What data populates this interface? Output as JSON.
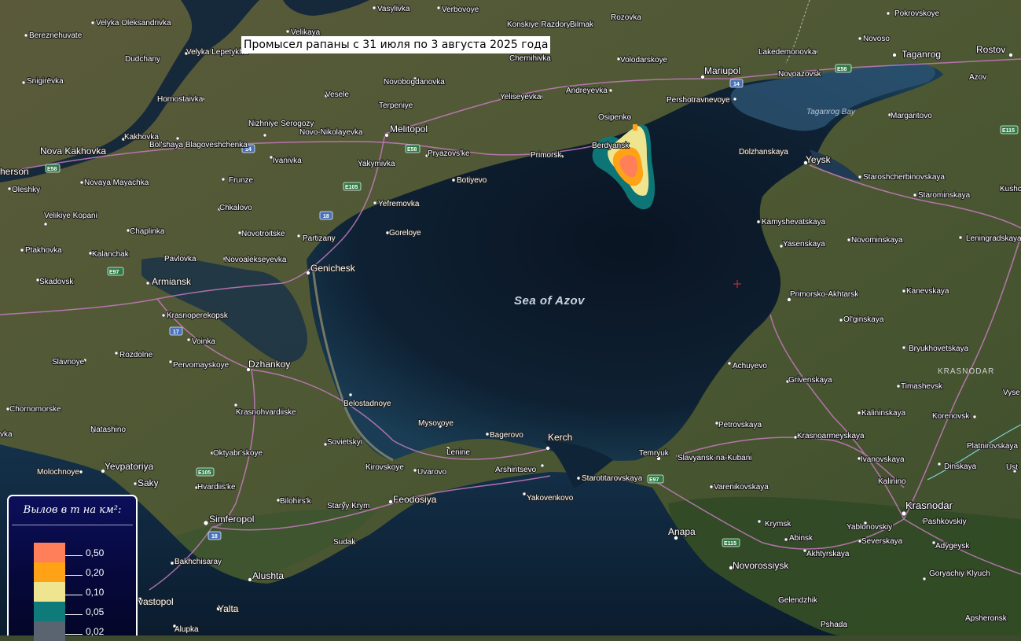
{
  "map": {
    "title": "Промысел рапаны с 31 июля по 3 августа 2025 года",
    "sea_label": "Sea of Azov",
    "bay_label": "Taganrog Bay",
    "region_label": "KRASNODAR",
    "colors": {
      "sea": "#0d1a2a",
      "land": "#4a5632",
      "roads": "#c77bbf"
    },
    "places": [
      {
        "id": "vasylivka",
        "name": "Vasylivka"
      },
      {
        "id": "verbovoye",
        "name": "Verbovoye"
      },
      {
        "id": "konskiye",
        "name": "Konskiye Razdory"
      },
      {
        "id": "bilmak",
        "name": "Bilmak"
      },
      {
        "id": "rozovka",
        "name": "Rozovka"
      },
      {
        "id": "pokrovskoye",
        "name": "Pokrovskoye"
      },
      {
        "id": "velyka",
        "name": "Velyka Oleksandrivka"
      },
      {
        "id": "bereznehuvate",
        "name": "Bereznehuvate"
      },
      {
        "id": "velikaya",
        "name": "Velikaya"
      },
      {
        "id": "novosvo",
        "name": "Novoso"
      },
      {
        "id": "dudchany",
        "name": "Dudchany"
      },
      {
        "id": "velyka_lep",
        "name": "Velyka Lepetykha"
      },
      {
        "id": "chernihivka",
        "name": "Chernihivka"
      },
      {
        "id": "volodarskoye",
        "name": "Volodarskoye"
      },
      {
        "id": "mariupol",
        "name": "Mariupol"
      },
      {
        "id": "lakedemonovka",
        "name": "Lakedemonovka"
      },
      {
        "id": "taganrog",
        "name": "Taganrog"
      },
      {
        "id": "rostov",
        "name": "Rostov"
      },
      {
        "id": "snigirevka",
        "name": "Snigirëvka"
      },
      {
        "id": "novobogdanovka",
        "name": "Novobogdanovka"
      },
      {
        "id": "novoazovsk",
        "name": "Novoazovsk"
      },
      {
        "id": "azov",
        "name": "Azov"
      },
      {
        "id": "andreyevka",
        "name": "Andreyevka"
      },
      {
        "id": "vesele",
        "name": "Vesele"
      },
      {
        "id": "yeliseyevka",
        "name": "Yeliseyevka"
      },
      {
        "id": "pershotravnevoye",
        "name": "Pershotravnevoye"
      },
      {
        "id": "hornostaivka",
        "name": "Hornostaivka"
      },
      {
        "id": "terpeniye",
        "name": "Terpeniye"
      },
      {
        "id": "osipenko",
        "name": "Osipenko"
      },
      {
        "id": "margaritovo",
        "name": "Margaritovo"
      },
      {
        "id": "nizhniye",
        "name": "Nizhniye Serogozy"
      },
      {
        "id": "melitopol",
        "name": "Melitopol"
      },
      {
        "id": "novo_nik",
        "name": "Novo-Nikolayevka"
      },
      {
        "id": "bolshaya",
        "name": "Bol'shaya Blagoveshchenka"
      },
      {
        "id": "kakhovka",
        "name": "Kakhovka"
      },
      {
        "id": "nova_kakhovka",
        "name": "Nova Kakhovka"
      },
      {
        "id": "pryazovske",
        "name": "Pryazovs'ke"
      },
      {
        "id": "primorsk",
        "name": "Primorsk"
      },
      {
        "id": "berdyansk",
        "name": "Berdyansk"
      },
      {
        "id": "kherson",
        "name": "Kherson"
      },
      {
        "id": "ivanivka",
        "name": "Ivanivka"
      },
      {
        "id": "yakymivka",
        "name": "Yakymivka"
      },
      {
        "id": "dolzhanskaya",
        "name": "Dolzhanskaya"
      },
      {
        "id": "yeysk",
        "name": "Yeysk"
      },
      {
        "id": "staroshcherb",
        "name": "Staroshcherbinovskaya"
      },
      {
        "id": "oleshky",
        "name": "Oleshky"
      },
      {
        "id": "novaya_may",
        "name": "Novaya Mayachka"
      },
      {
        "id": "botiyevo",
        "name": "Botiyevo"
      },
      {
        "id": "frunze",
        "name": "Frunze"
      },
      {
        "id": "starominskaya",
        "name": "Starominskaya"
      },
      {
        "id": "yefremovka",
        "name": "Yefremovka"
      },
      {
        "id": "chkalovo",
        "name": "Chkalovo"
      },
      {
        "id": "velikiye_kopani",
        "name": "Velikiye Kopani"
      },
      {
        "id": "kamyshevatskaya",
        "name": "Kamyshevatskaya"
      },
      {
        "id": "goreloye",
        "name": "Goreloye"
      },
      {
        "id": "novotroitske",
        "name": "Novotroitske"
      },
      {
        "id": "chaplinka",
        "name": "Chaplinka"
      },
      {
        "id": "partizany",
        "name": "Partizany"
      },
      {
        "id": "leningradskaya",
        "name": "Leningradskaya"
      },
      {
        "id": "novominskaya",
        "name": "Novominskaya"
      },
      {
        "id": "yasenskaya",
        "name": "Yasenskaya"
      },
      {
        "id": "ptakhovka",
        "name": "Ptakhovka"
      },
      {
        "id": "kalanchak",
        "name": "Kalanchak"
      },
      {
        "id": "pavlovka",
        "name": "Pavlovka"
      },
      {
        "id": "novoalekseyevka",
        "name": "Novoalekseyevka"
      },
      {
        "id": "genichesk",
        "name": "Genichesk"
      },
      {
        "id": "skadovsk",
        "name": "Skadovsk"
      },
      {
        "id": "armiansk",
        "name": "Armiansk"
      },
      {
        "id": "primorsko",
        "name": "Primorsko-Akhtarsk"
      },
      {
        "id": "kanevskaya",
        "name": "Kanevskaya"
      },
      {
        "id": "krasnoperekopsk",
        "name": "Krasnoperekopsk"
      },
      {
        "id": "olginskaya",
        "name": "Ol'ginskaya"
      },
      {
        "id": "voinka",
        "name": "Voinka"
      },
      {
        "id": "bryukhovetskaya",
        "name": "Bryukhovetskaya"
      },
      {
        "id": "rozdolne",
        "name": "Rozdolne"
      },
      {
        "id": "slavnoye",
        "name": "Slavnoye"
      },
      {
        "id": "pervomayskoye",
        "name": "Pervomayskoye"
      },
      {
        "id": "dzhankoy",
        "name": "Dzhankoy"
      },
      {
        "id": "achuyevo",
        "name": "Achuyevo"
      },
      {
        "id": "grivenskaya",
        "name": "Grivenskaya"
      },
      {
        "id": "timashevsk",
        "name": "Timashevsk"
      },
      {
        "id": "belostadnoye",
        "name": "Belostadnoye"
      },
      {
        "id": "chornomorske",
        "name": "Chornomorske"
      },
      {
        "id": "krasnohvardiiske",
        "name": "Krasnohvardiiske"
      },
      {
        "id": "kalininskaya",
        "name": "Kalininskaya"
      },
      {
        "id": "korenovsk",
        "name": "Korenovsk"
      },
      {
        "id": "mysovoye",
        "name": "Mysovoye"
      },
      {
        "id": "petrovskaya",
        "name": "Petrovskaya"
      },
      {
        "id": "natashino",
        "name": "Natashino"
      },
      {
        "id": "bagerovo",
        "name": "Bagerovo"
      },
      {
        "id": "kerch",
        "name": "Kerch"
      },
      {
        "id": "krasnoarmeyskaya",
        "name": "Krasnoarmeyskaya"
      },
      {
        "id": "sovietskyi",
        "name": "Sovietskyi"
      },
      {
        "id": "platnirovskaya",
        "name": "Platnirovskaya"
      },
      {
        "id": "lenine",
        "name": "Lenine"
      },
      {
        "id": "oktyabrskoye",
        "name": "Oktyabr'skoye"
      },
      {
        "id": "temryuk",
        "name": "Temryuk"
      },
      {
        "id": "slavyansk",
        "name": "Slavyansk-na-Kubani"
      },
      {
        "id": "ivanovskaya",
        "name": "Ivanovskaya"
      },
      {
        "id": "yevpatoriya",
        "name": "Yevpatoriya"
      },
      {
        "id": "kirovskoye",
        "name": "Kirovskoye"
      },
      {
        "id": "uvarovo",
        "name": "Uvarovo"
      },
      {
        "id": "arshintsevo",
        "name": "Arshintsevo"
      },
      {
        "id": "dinskaya",
        "name": "Dinskaya"
      },
      {
        "id": "molochnoye",
        "name": "Molochnoye"
      },
      {
        "id": "saky",
        "name": "Saky"
      },
      {
        "id": "starotitarovskaya",
        "name": "Starotitarovskaya"
      },
      {
        "id": "kalinino",
        "name": "Kalinino"
      },
      {
        "id": "hvardiiske",
        "name": "Hvardiis'ke"
      },
      {
        "id": "varenikovskaya",
        "name": "Varenikovskaya"
      },
      {
        "id": "bilohirsk",
        "name": "Bilohirs'k"
      },
      {
        "id": "staryy_krym",
        "name": "Staryy Krym"
      },
      {
        "id": "feodosiya",
        "name": "Feodosiya"
      },
      {
        "id": "yakovenkovo",
        "name": "Yakovenkovo"
      },
      {
        "id": "krasnodar",
        "name": "Krasnodar"
      },
      {
        "id": "pashkovskiy",
        "name": "Pashkovskiy"
      },
      {
        "id": "simferopol",
        "name": "Simferopol"
      },
      {
        "id": "krymsk",
        "name": "Krymsk"
      },
      {
        "id": "yablonovskiy",
        "name": "Yablonovskiy"
      },
      {
        "id": "anapa",
        "name": "Anapa"
      },
      {
        "id": "abinsk",
        "name": "Abinsk"
      },
      {
        "id": "severskaya",
        "name": "Severskaya"
      },
      {
        "id": "sudak",
        "name": "Sudak"
      },
      {
        "id": "adygeysk",
        "name": "Adygeysk"
      },
      {
        "id": "akhtyrskaya",
        "name": "Akhtyrskaya"
      },
      {
        "id": "bakhchisaray",
        "name": "Bakhchisaray"
      },
      {
        "id": "novorossiysk",
        "name": "Novorossiysk"
      },
      {
        "id": "goryachiy",
        "name": "Goryachiy Klyuch"
      },
      {
        "id": "alushta",
        "name": "Alushta"
      },
      {
        "id": "gelendzhik",
        "name": "Gelendzhik"
      },
      {
        "id": "sevastopol",
        "name": "vastopol"
      },
      {
        "id": "yalta",
        "name": "Yalta"
      },
      {
        "id": "alupka",
        "name": "Alupka"
      },
      {
        "id": "pshada",
        "name": "Pshada"
      },
      {
        "id": "apsheronsk",
        "name": "Apsheronsk"
      },
      {
        "id": "kushch",
        "name": "Kushch"
      },
      {
        "id": "vyse",
        "name": "Vyse"
      },
      {
        "id": "ust",
        "name": "Ust"
      },
      {
        "id": "vka",
        "name": "vka"
      },
      {
        "id": "herson",
        "name": "herson"
      }
    ],
    "road_shields": [
      "E58",
      "14",
      "E58",
      "E105",
      "18",
      "E97",
      "17",
      "E105",
      "18",
      "E97",
      "E115",
      "E115",
      "E58",
      "14"
    ]
  },
  "legend": {
    "title": "Вылов в т на км²:",
    "items": [
      {
        "label": "0,50",
        "color": "#ff7f5a"
      },
      {
        "label": "0,20",
        "color": "#ffa215"
      },
      {
        "label": "0,10",
        "color": "#efe48f"
      },
      {
        "label": "0,05",
        "color": "#0f7a7a"
      },
      {
        "label": "0,02",
        "color": "#5a6470"
      }
    ]
  }
}
